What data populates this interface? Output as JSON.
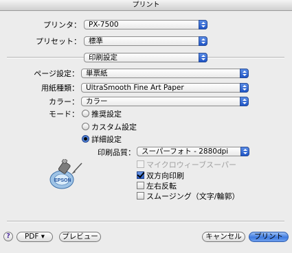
{
  "window": {
    "title": "プリント"
  },
  "printer": {
    "label": "プリンタ：",
    "value": "PX-7500"
  },
  "preset": {
    "label": "プリセット：",
    "value": "標準"
  },
  "panel": {
    "value": "印刷設定"
  },
  "page_setting": {
    "label": "ページ設定：",
    "value": "単票紙"
  },
  "paper_type": {
    "label": "用紙種類：",
    "value": "UltraSmooth Fine Art Paper"
  },
  "color": {
    "label": "カラー：",
    "value": "カラー"
  },
  "mode": {
    "label": "モード：",
    "options": [
      {
        "label": "推奨設定",
        "selected": false
      },
      {
        "label": "カスタム設定",
        "selected": false
      },
      {
        "label": "詳細設定",
        "selected": true
      }
    ]
  },
  "quality": {
    "label": "印刷品質：",
    "value": "スーパーフォト - 2880dpi"
  },
  "options": [
    {
      "label": "マイクロウィーブスーパー",
      "checked": false,
      "enabled": false
    },
    {
      "label": "双方向印刷",
      "checked": true,
      "enabled": true
    },
    {
      "label": "左右反転",
      "checked": false,
      "enabled": true
    },
    {
      "label": "スムージング（文字/輪郭）",
      "checked": false,
      "enabled": true
    }
  ],
  "icon": {
    "name": "printer-icon",
    "logo_text": "EPSON"
  },
  "buttons": {
    "help": "?",
    "pdf": "PDF ▾",
    "preview": "プレビュー",
    "cancel": "キャンセル",
    "print": "プリント"
  },
  "colors": {
    "accent": "#2a5dc6",
    "window_bg": "#ececec"
  }
}
